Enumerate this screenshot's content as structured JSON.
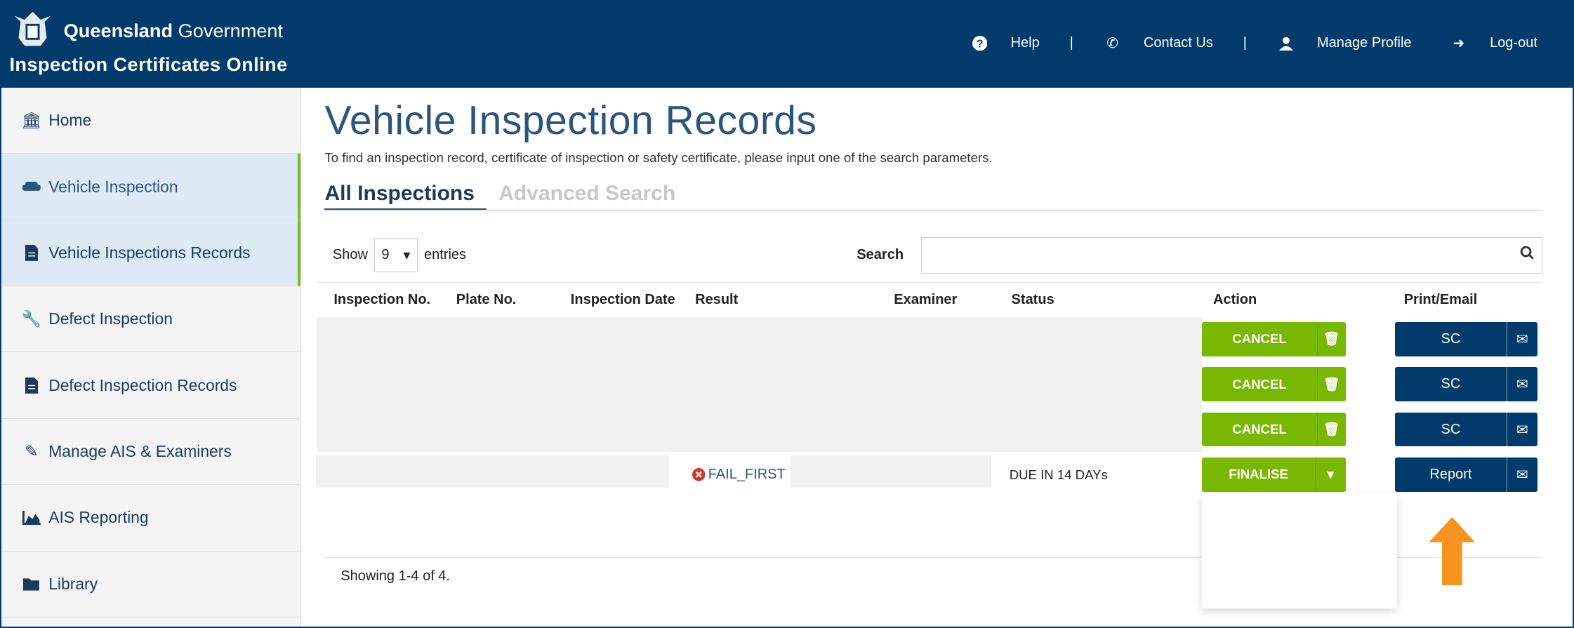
{
  "header": {
    "brand_bold": "Queensland",
    "brand_light": "Government",
    "app_title": "Inspection Certificates Online",
    "nav": [
      {
        "label": "Help",
        "icon": "question-circle-icon"
      },
      {
        "label": "Contact Us",
        "icon": "phone-icon"
      },
      {
        "label": "Manage Profile",
        "icon": "user-icon"
      },
      {
        "label": "Log-out",
        "icon": "sign-out-icon"
      }
    ],
    "separator": "|"
  },
  "sidebar": {
    "items": [
      {
        "label": "Home"
      },
      {
        "label": "Vehicle Inspection"
      },
      {
        "label": "Vehicle Inspections Records"
      },
      {
        "label": "Defect Inspection"
      },
      {
        "label": "Defect Inspection Records"
      },
      {
        "label": "Manage AIS & Examiners"
      },
      {
        "label": "AIS Reporting"
      },
      {
        "label": "Library"
      }
    ]
  },
  "main": {
    "title": "Vehicle Inspection Records",
    "intro": "To find an inspection record, certificate of inspection or safety certificate, please input one of the search parameters.",
    "tabs": [
      {
        "label": "All Inspections"
      },
      {
        "label": "Advanced Search"
      }
    ],
    "show_label": "Show",
    "entries_value": "9",
    "entries_label": "entries",
    "search_label": "Search",
    "search_value": "",
    "columns": [
      "Inspection No.",
      "Plate No.",
      "Inspection Date",
      "Result",
      "Examiner",
      "Status",
      "Action",
      "Print/Email"
    ],
    "rows": [
      {
        "action": "CANCEL",
        "print": "SC"
      },
      {
        "action": "CANCEL",
        "print": "SC"
      },
      {
        "action": "CANCEL",
        "print": "SC"
      },
      {
        "result": "FAIL_FIRST",
        "status": "DUE IN 14 DAYs",
        "action": "FINALISE",
        "print": "Report"
      }
    ],
    "footer": "Showing 1-4 of 4."
  },
  "colors": {
    "brand": "#003b6b",
    "green": "#78b800",
    "accent_arrow": "#f7941d"
  }
}
